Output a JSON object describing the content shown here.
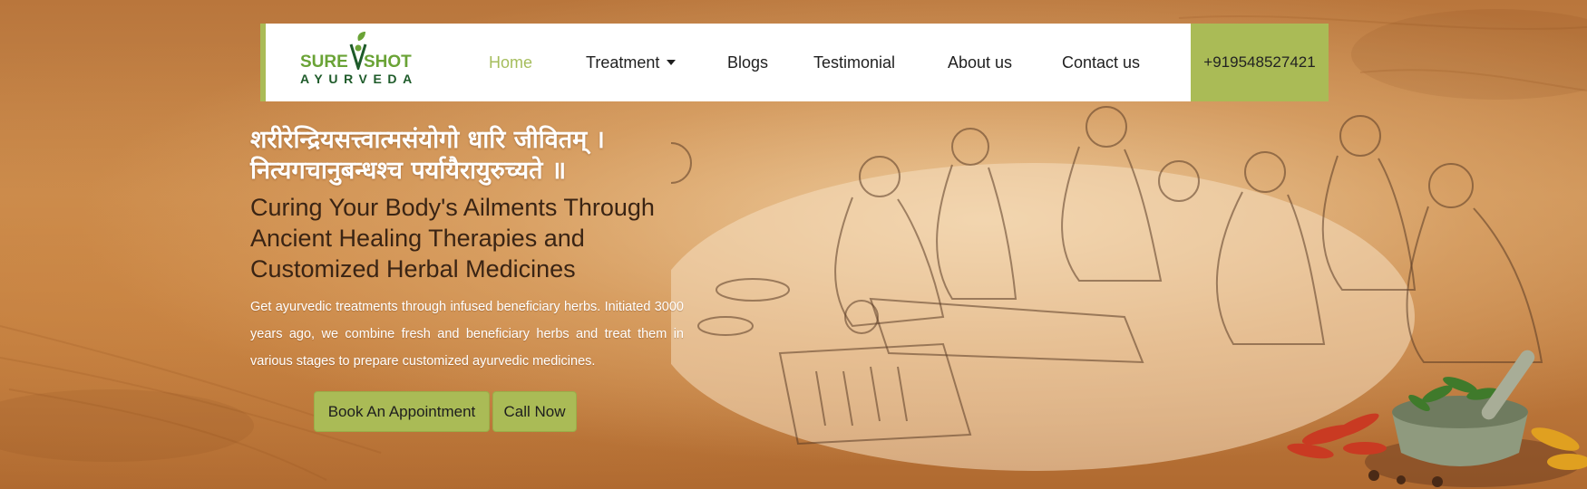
{
  "brand": {
    "logo_top_left": "SURE",
    "logo_top_right": "SHOT",
    "logo_bottom": "AYURVEDA"
  },
  "nav": {
    "items": [
      {
        "label": "Home",
        "active": true
      },
      {
        "label": "Treatment",
        "dropdown": true
      },
      {
        "label": "Blogs"
      },
      {
        "label": "Testimonial"
      },
      {
        "label": "About us"
      },
      {
        "label": "Contact us"
      }
    ],
    "phone": "+919548527421"
  },
  "hero": {
    "sanskrit_line1": "शरीरेन्द्रियसत्त्वात्मसंयोगो धारि जीवितम् ।",
    "sanskrit_line2": "नित्यगचानुबन्धश्च पर्यायैरायुरुच्यते ॥",
    "headline": "Curing Your Body's Ailments Through Ancient Healing Therapies and Customized Herbal Medicines",
    "description": "Get ayurvedic treatments through infused beneficiary herbs. Initiated 3000 years ago, we combine fresh and beneficiary herbs and treat them in various stages to prepare customized ayurvedic medicines.",
    "book_button": "Book An Appointment",
    "call_button": "Call Now"
  },
  "colors": {
    "accent": "#aabb56",
    "active_nav": "#a5bd5c",
    "logo_green": "#6aa336",
    "logo_dark": "#1e5b2a"
  },
  "icons": [
    "leaf-logo-icon",
    "caret-down-icon"
  ]
}
